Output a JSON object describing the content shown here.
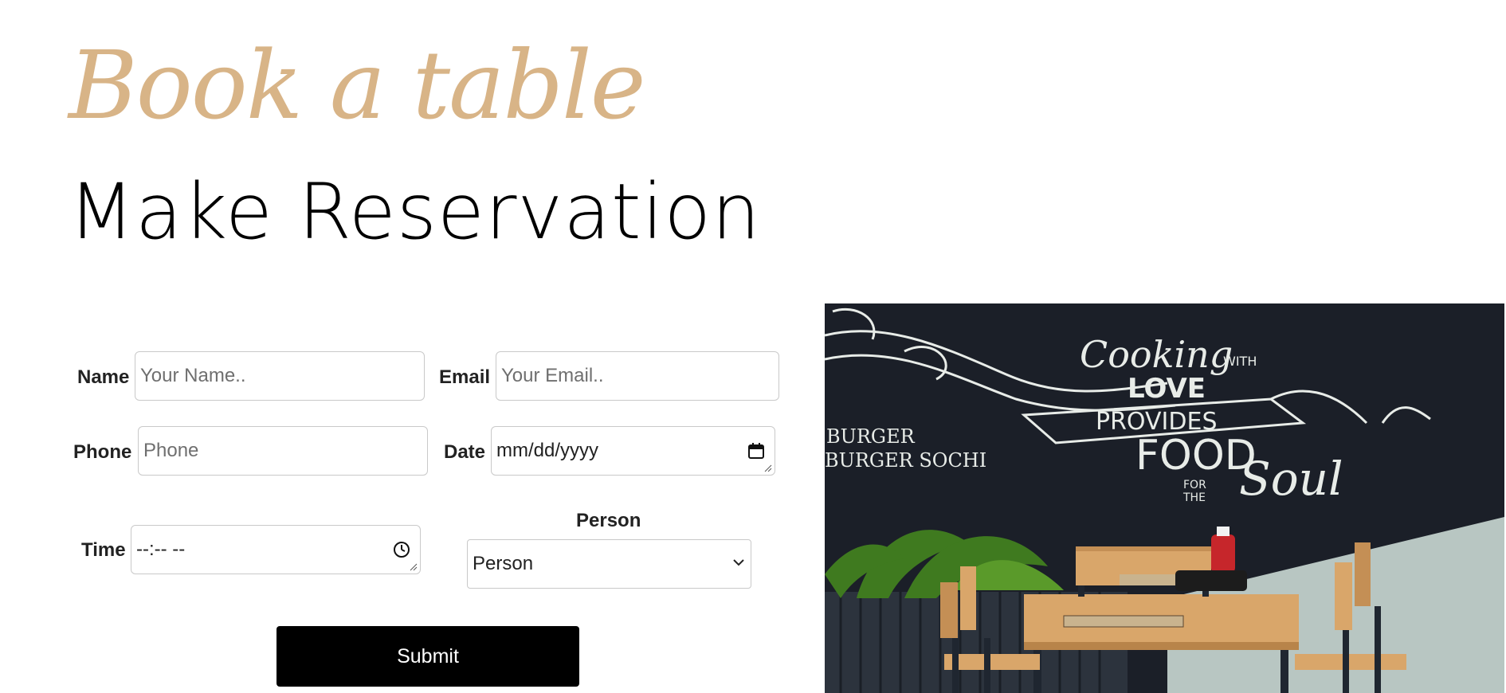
{
  "header": {
    "script_title": "Book a table",
    "title": "Make Reservation"
  },
  "form": {
    "name": {
      "label": "Name",
      "placeholder": "Your Name.."
    },
    "email": {
      "label": "Email",
      "placeholder": "Your Email.."
    },
    "phone": {
      "label": "Phone",
      "placeholder": "Phone"
    },
    "date": {
      "label": "Date",
      "value": "mm/dd/yyyy",
      "icon": "calendar-icon"
    },
    "time": {
      "label": "Time",
      "value": "--:-- --",
      "icon": "clock-icon"
    },
    "person": {
      "label": "Person",
      "selected": "Person",
      "icon": "chevron-down-icon"
    },
    "submit_label": "Submit"
  },
  "photo": {
    "chalk_lines": [
      "Cooking",
      "WITH",
      "LOVE",
      "PROVIDES",
      "FOOD",
      "FOR",
      "THE",
      "Soul"
    ],
    "side_lines": [
      "BURGER",
      "BURGER SOCHI"
    ],
    "colors": {
      "chalkboard": "#1b1f28",
      "wall": "#b8c6c2",
      "wood": "#d9a66a",
      "plant": "#3f7a1f",
      "bottle": "#c6262b"
    }
  },
  "colors": {
    "accent": "#d8b487",
    "text": "#000000",
    "button_bg": "#000000",
    "button_text": "#ffffff"
  }
}
